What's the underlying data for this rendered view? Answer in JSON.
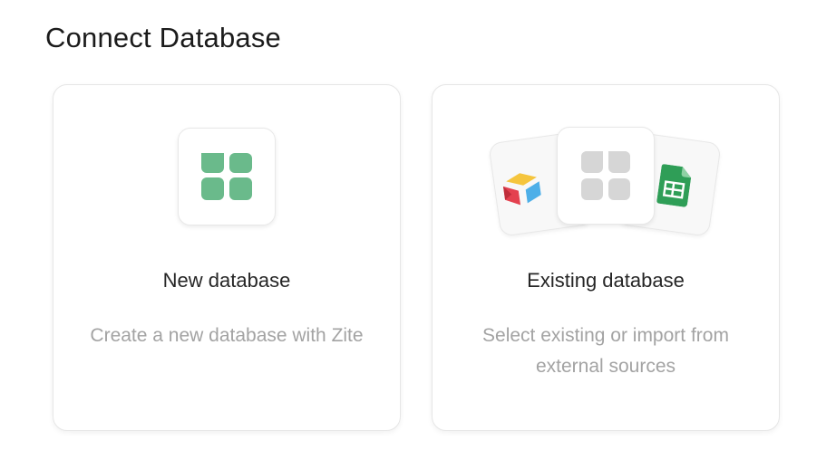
{
  "page": {
    "title": "Connect Database"
  },
  "cards": [
    {
      "title": "New database",
      "description": "Create a new database with Zite",
      "icon": "green-table-icon"
    },
    {
      "title": "Existing database",
      "description": "Select existing or import from external sources",
      "icons": [
        "airtable-icon",
        "gray-table-icon",
        "google-sheets-icon"
      ]
    }
  ],
  "colors": {
    "accent_green": "#6aba8b",
    "sheets_green": "#2f9e57",
    "airtable_yellow": "#f5c53e",
    "airtable_red": "#e4414f",
    "airtable_blue": "#4dafe8",
    "gray_icon": "#d6d6d6"
  }
}
